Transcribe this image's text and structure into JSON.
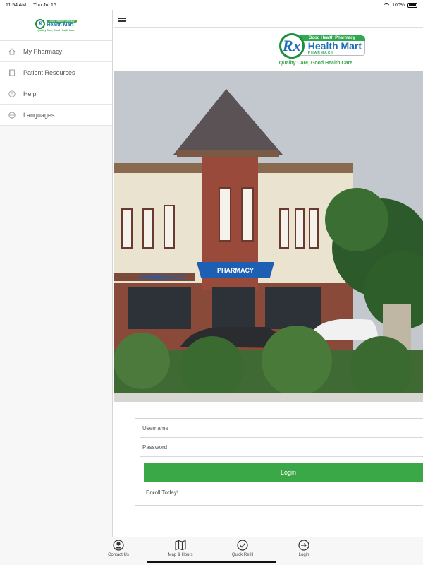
{
  "status_bar": {
    "time": "11:54 AM",
    "date": "Thu Jul 16",
    "battery": "100%"
  },
  "sidebar": {
    "logo": {
      "banner": "Good Health Pharmacy",
      "brand": "Health Mart",
      "tagline": "Quality Care, Good Health Care"
    },
    "items": [
      {
        "label": "My Pharmacy",
        "icon": "home-icon"
      },
      {
        "label": "Patient Resources",
        "icon": "book-icon"
      },
      {
        "label": "Help",
        "icon": "help-icon"
      },
      {
        "label": "Languages",
        "icon": "globe-icon"
      }
    ]
  },
  "header": {
    "logo_rx": "Rx",
    "logo_banner": "Good Health Pharmacy",
    "logo_brand": "Health Mart",
    "logo_sub": "PHARMACY",
    "tagline": "Quality Care, Good Health Care"
  },
  "photo": {
    "sign_center": "PHARMACY",
    "sign_left": "PHARMACY"
  },
  "login": {
    "username_placeholder": "Username",
    "password_placeholder": "Password",
    "button_label": "Login",
    "enroll_label": "Enroll Today!"
  },
  "tabbar": {
    "items": [
      {
        "label": "Contact Us",
        "icon": "contact-icon"
      },
      {
        "label": "Map & Hours",
        "icon": "map-icon"
      },
      {
        "label": "Quick Refill",
        "icon": "check-icon"
      },
      {
        "label": "Login",
        "icon": "login-icon"
      }
    ]
  },
  "colors": {
    "brand_green": "#3aa847",
    "brand_blue": "#1e6fb8"
  }
}
